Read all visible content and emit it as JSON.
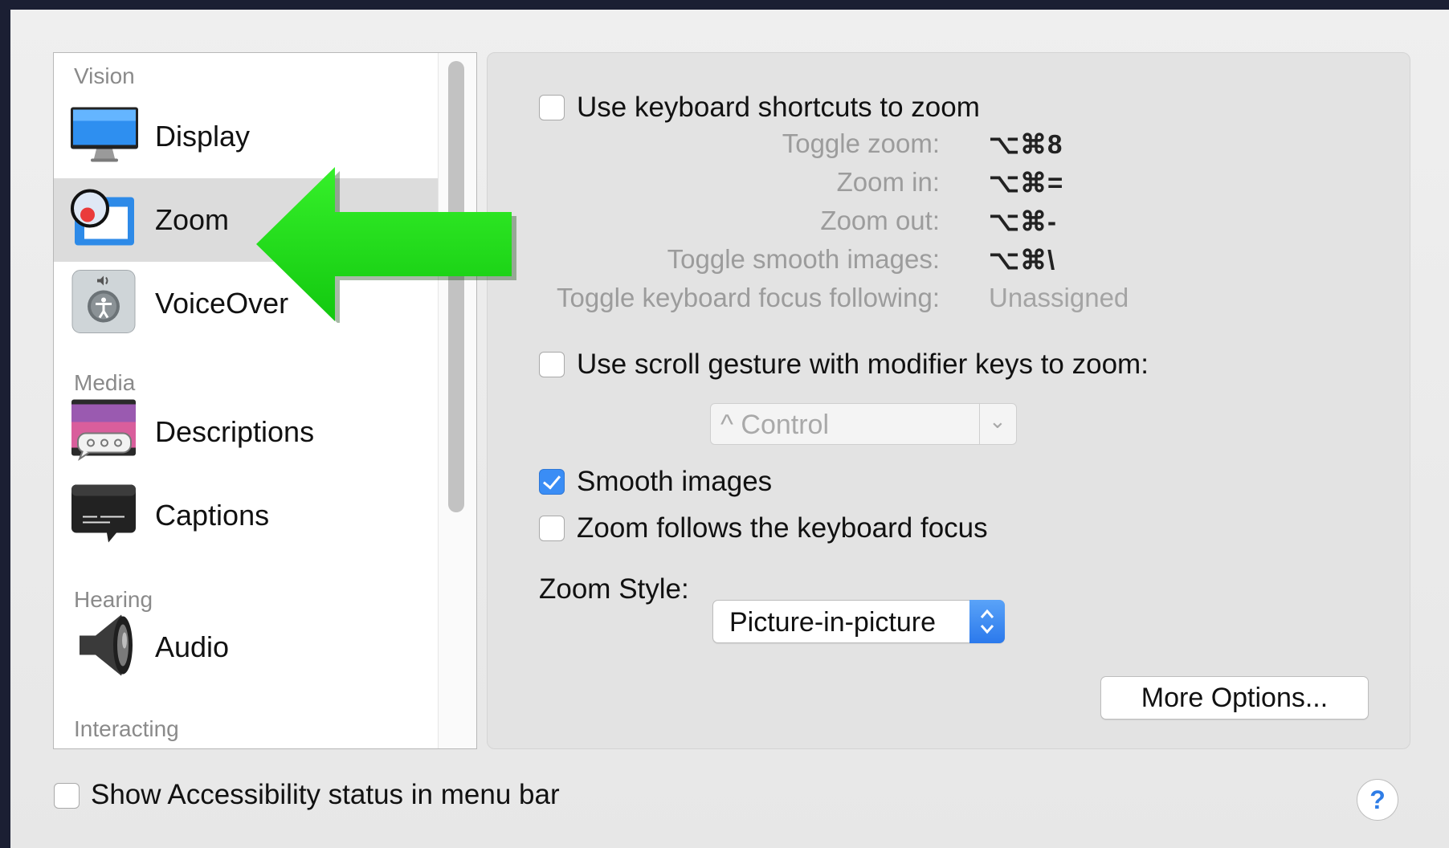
{
  "sidebar": {
    "sections": [
      {
        "header": "Vision"
      },
      {
        "header": "Media"
      },
      {
        "header": "Hearing"
      },
      {
        "header": "Interacting"
      }
    ],
    "items": [
      {
        "label": "Display",
        "icon": "display-icon"
      },
      {
        "label": "Zoom",
        "icon": "zoom-icon",
        "selected": true
      },
      {
        "label": "VoiceOver",
        "icon": "voiceover-icon"
      },
      {
        "label": "Descriptions",
        "icon": "descriptions-icon"
      },
      {
        "label": "Captions",
        "icon": "captions-icon"
      },
      {
        "label": "Audio",
        "icon": "speaker-icon"
      }
    ]
  },
  "zoom": {
    "keyboard_shortcuts": {
      "label": "Use keyboard shortcuts to zoom",
      "checked": false
    },
    "shortcuts": [
      {
        "name": "Toggle zoom:",
        "keys": "⌥⌘8"
      },
      {
        "name": "Zoom in:",
        "keys": "⌥⌘="
      },
      {
        "name": "Zoom out:",
        "keys": "⌥⌘-"
      },
      {
        "name": "Toggle smooth images:",
        "keys": "⌥⌘\\"
      },
      {
        "name": "Toggle keyboard focus following:",
        "keys": "Unassigned"
      }
    ],
    "scroll_gesture": {
      "label": "Use scroll gesture with modifier keys to zoom:",
      "checked": false
    },
    "modifier_select": {
      "value": "^ Control"
    },
    "smooth_images": {
      "label": "Smooth images",
      "checked": true
    },
    "follow_focus": {
      "label": "Zoom follows the keyboard focus",
      "checked": false
    },
    "zoom_style": {
      "label": "Zoom Style:",
      "value": "Picture-in-picture"
    },
    "more_options": "More Options..."
  },
  "footer": {
    "status_label": "Show Accessibility status in menu bar",
    "status_checked": false,
    "help": "?"
  },
  "colors": {
    "accent": "#3a8df5",
    "annotation_arrow": "#22e01a"
  }
}
